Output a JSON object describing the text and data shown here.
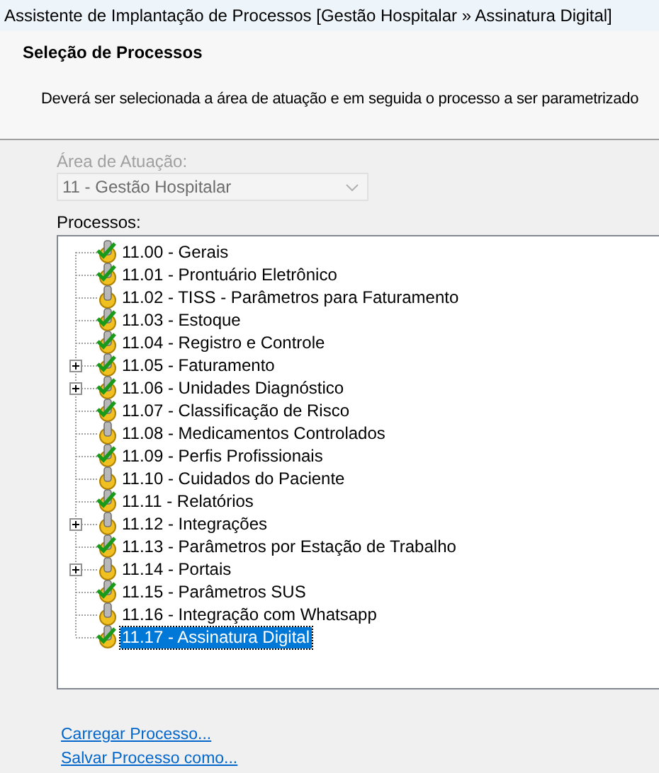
{
  "window": {
    "title": "Assistente de Implantação de Processos [Gestão Hospitalar » Assinatura Digital]"
  },
  "header": {
    "title": "Seleção de Processos",
    "description": "Deverá ser selecionada a área de atuação e em seguida o processo a ser parametrizado"
  },
  "area": {
    "label": "Área de Atuação:",
    "value": "11 - Gestão Hospitalar",
    "disabled": true
  },
  "processes": {
    "label": "Processos:",
    "items": [
      {
        "text": "11.00 - Gerais",
        "done": true,
        "expandable": false,
        "selected": false
      },
      {
        "text": "11.01 - Prontuário Eletrônico",
        "done": true,
        "expandable": false,
        "selected": false
      },
      {
        "text": "11.02 - TISS - Parâmetros para Faturamento",
        "done": false,
        "expandable": false,
        "selected": false
      },
      {
        "text": "11.03 - Estoque",
        "done": true,
        "expandable": false,
        "selected": false
      },
      {
        "text": "11.04 - Registro e Controle",
        "done": true,
        "expandable": false,
        "selected": false
      },
      {
        "text": "11.05 - Faturamento",
        "done": true,
        "expandable": true,
        "selected": false
      },
      {
        "text": "11.06 - Unidades Diagnóstico",
        "done": true,
        "expandable": true,
        "selected": false
      },
      {
        "text": "11.07 - Classificação de Risco",
        "done": true,
        "expandable": false,
        "selected": false
      },
      {
        "text": "11.08 - Medicamentos Controlados",
        "done": false,
        "expandable": false,
        "selected": false
      },
      {
        "text": "11.09 - Perfis Profissionais",
        "done": true,
        "expandable": false,
        "selected": false
      },
      {
        "text": "11.10 - Cuidados do Paciente",
        "done": false,
        "expandable": false,
        "selected": false
      },
      {
        "text": "11.11 - Relatórios",
        "done": true,
        "expandable": false,
        "selected": false
      },
      {
        "text": "11.12 - Integrações",
        "done": false,
        "expandable": true,
        "selected": false
      },
      {
        "text": "11.13 - Parâmetros por Estação de Trabalho",
        "done": true,
        "expandable": false,
        "selected": false
      },
      {
        "text": "11.14 - Portais",
        "done": false,
        "expandable": true,
        "selected": false
      },
      {
        "text": "11.15 - Parâmetros SUS",
        "done": true,
        "expandable": false,
        "selected": false
      },
      {
        "text": "11.16 - Integração com Whatsapp",
        "done": false,
        "expandable": false,
        "selected": false
      },
      {
        "text": "11.17 - Assinatura Digital",
        "done": true,
        "expandable": false,
        "selected": true
      }
    ]
  },
  "links": [
    "Carregar Processo...",
    "Salvar Processo como..."
  ]
}
